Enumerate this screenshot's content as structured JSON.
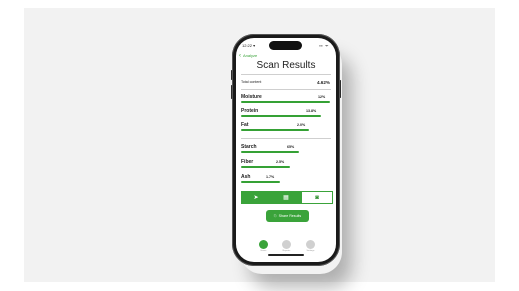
{
  "status": {
    "time": "12:22 ▾",
    "icons": "▪▪ ᯤ"
  },
  "header": {
    "back_label": "Analyze",
    "title": "Scan Results"
  },
  "summary": {
    "label": "Total content",
    "value": "4.62%"
  },
  "nutrients": [
    {
      "name": "Moisture",
      "value": "12%",
      "level": 0.97
    },
    {
      "name": "Protein",
      "value": "13.8%",
      "level": 0.87
    },
    {
      "name": "Fat",
      "value": "2.0%",
      "level": 0.74
    },
    {
      "name": "Starch",
      "value": "65%",
      "level": 0.63
    },
    {
      "name": "Fiber",
      "value": "2.5%",
      "level": 0.53
    },
    {
      "name": "Ash",
      "value": "1.7%",
      "level": 0.42
    }
  ],
  "tabs": [
    {
      "icon": "navigation-arrow-icon",
      "glyph": "➤"
    },
    {
      "icon": "calculator-icon",
      "glyph": "▦"
    },
    {
      "icon": "camera-icon",
      "glyph": "◙"
    }
  ],
  "share": {
    "label": "Share Results",
    "icon": "share-icon",
    "glyph": "⎋"
  },
  "bottom_nav": [
    {
      "label": "Home",
      "color": "#3aa33a"
    },
    {
      "label": "Reports",
      "color": "#d0d0d0"
    },
    {
      "label": "Settings",
      "color": "#d0d0d0"
    }
  ],
  "colors": {
    "accent": "#3aa33a",
    "bar": "#35a135"
  }
}
